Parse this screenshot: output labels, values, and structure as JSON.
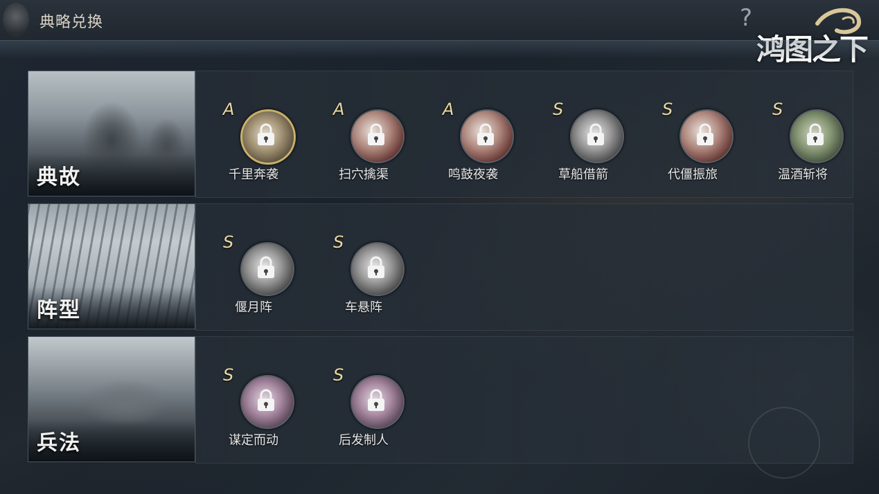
{
  "header": {
    "title": "典略兑换",
    "help_label": "?",
    "logo_text": "鸿图之下"
  },
  "sections": [
    {
      "label": "典故",
      "skills": [
        {
          "grade": "A",
          "name": "千里奔袭",
          "selected": true,
          "art": "gold"
        },
        {
          "grade": "A",
          "name": "扫穴擒渠",
          "selected": false,
          "art": "red"
        },
        {
          "grade": "A",
          "name": "鸣鼓夜袭",
          "selected": false,
          "art": "red"
        },
        {
          "grade": "S",
          "name": "草船借箭",
          "selected": false,
          "art": "grey"
        },
        {
          "grade": "S",
          "name": "代僵振旅",
          "selected": false,
          "art": "red"
        },
        {
          "grade": "S",
          "name": "温酒斩将",
          "selected": false,
          "art": "green"
        }
      ]
    },
    {
      "label": "阵型",
      "skills": [
        {
          "grade": "S",
          "name": "偃月阵",
          "selected": false,
          "art": "grey"
        },
        {
          "grade": "S",
          "name": "车悬阵",
          "selected": false,
          "art": "grey"
        }
      ]
    },
    {
      "label": "兵法",
      "skills": [
        {
          "grade": "S",
          "name": "谋定而动",
          "selected": false,
          "art": "purple"
        },
        {
          "grade": "S",
          "name": "后发制人",
          "selected": false,
          "art": "purple"
        }
      ]
    }
  ],
  "colors": {
    "grade": "#e9d9a2",
    "selected_ring": "#c9b068",
    "background": "#1e2731"
  }
}
